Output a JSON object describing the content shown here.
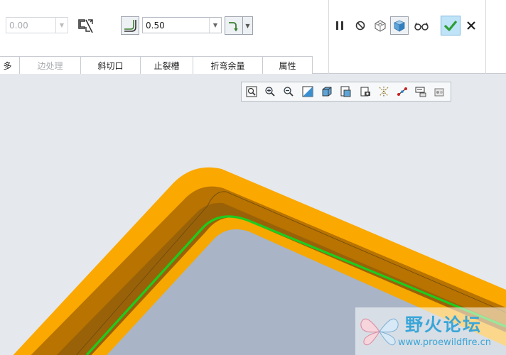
{
  "toolbar": {
    "disabled_value": "0.00",
    "thickness_value": "0.50"
  },
  "tabs": [
    {
      "label": "多"
    },
    {
      "label": "边处理"
    },
    {
      "label": "斜切口"
    },
    {
      "label": "止裂槽"
    },
    {
      "label": "折弯余量"
    },
    {
      "label": "属性"
    }
  ],
  "actions": {
    "icons": [
      "pause-icon",
      "stop-icon",
      "preview-mesh-icon",
      "preview-solid-icon",
      "verify-glasses-icon",
      "ok-check-icon",
      "cancel-x-icon"
    ]
  },
  "view_toolbar": {
    "icons": [
      "zoom-fit-icon",
      "zoom-in-icon",
      "zoom-out-icon",
      "repaint-icon",
      "display-style-icon",
      "saved-views-icon",
      "view-manager-icon",
      "datum-display-icon",
      "spin-center-icon",
      "annotation-display-icon",
      "appearance-icon"
    ]
  },
  "colors": {
    "flange_orange": "#fba800",
    "flange_shadow": "#b97300",
    "base_face": "#a9b5c6",
    "edge_green": "#1ecc1e",
    "accent_check": "#2e9e35"
  },
  "watermark": {
    "title": "野火论坛",
    "url": "www.proewildfire.cn"
  }
}
